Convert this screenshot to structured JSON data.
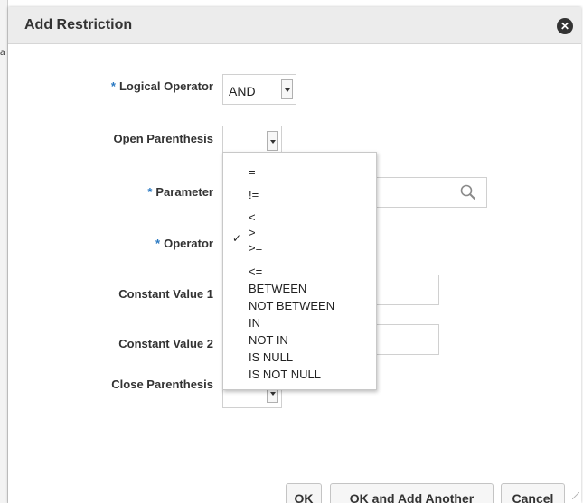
{
  "dialog": {
    "title": "Add Restriction",
    "close_icon": "close-icon"
  },
  "edge_glyph": "a",
  "form": {
    "required_marker": "*",
    "logical_operator": {
      "label": "Logical Operator",
      "value": "AND",
      "required": true
    },
    "open_parenthesis": {
      "label": "Open Parenthesis",
      "value": "",
      "required": false
    },
    "parameter": {
      "label": "Parameter",
      "value": "",
      "required": true,
      "icon": "search-icon"
    },
    "operator": {
      "label": "Operator",
      "value": ">",
      "required": true
    },
    "constant_value_1": {
      "label": "Constant Value 1",
      "value": ""
    },
    "constant_value_2": {
      "label": "Constant Value 2",
      "value": ""
    },
    "close_parenthesis": {
      "label": "Close Parenthesis",
      "value": ""
    }
  },
  "operator_dropdown": {
    "options": [
      "=",
      "!=",
      "<",
      ">",
      ">=",
      "<=",
      "BETWEEN",
      "NOT BETWEEN",
      "IN",
      "NOT IN",
      "IS NULL",
      "IS NOT NULL"
    ],
    "selected": ">",
    "check_mark": "✓"
  },
  "buttons": {
    "ok": "OK",
    "ok_and_add_another": "OK and Add Another",
    "cancel": "Cancel"
  },
  "colors": {
    "required_marker": "#2a79c2",
    "title_bar": "#ececec"
  }
}
